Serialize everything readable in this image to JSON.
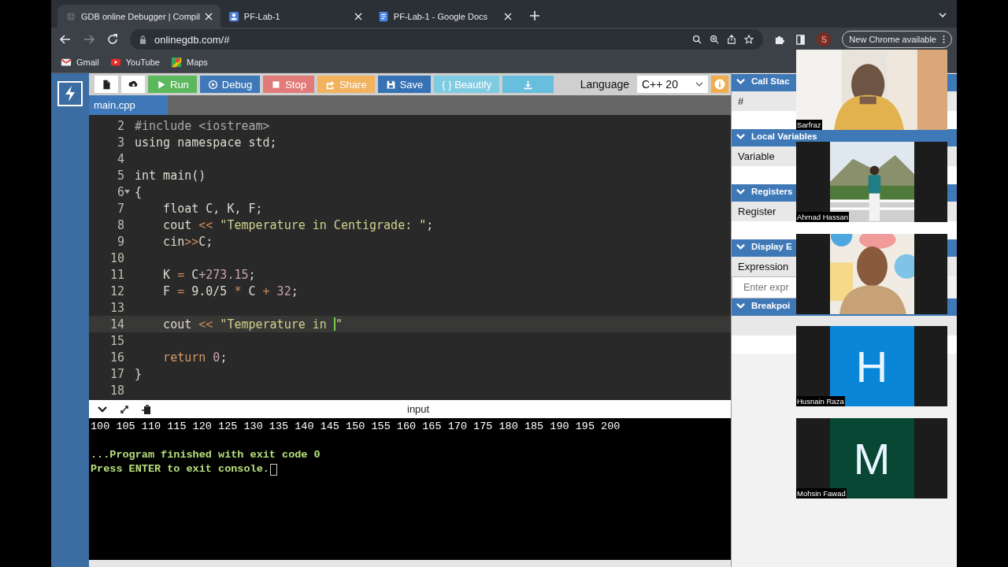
{
  "browser": {
    "tabs": [
      {
        "title": "GDB online Debugger | Compil",
        "selected": true
      },
      {
        "title": "PF-Lab-1",
        "selected": false
      },
      {
        "title": "PF-Lab-1 - Google Docs",
        "selected": false
      }
    ],
    "address": "onlinegdb.com/#",
    "bookmarks": [
      {
        "label": "Gmail"
      },
      {
        "label": "YouTube"
      },
      {
        "label": "Maps"
      }
    ],
    "profile": "S",
    "update_button": "New Chrome available"
  },
  "toolbar": {
    "buttons": [
      {
        "kind": "new-file"
      },
      {
        "kind": "upload"
      },
      {
        "kind": "run",
        "label": "Run"
      },
      {
        "kind": "debug",
        "label": "Debug"
      },
      {
        "kind": "stop",
        "label": "Stop"
      },
      {
        "kind": "share",
        "label": "Share"
      },
      {
        "kind": "save",
        "label": "Save"
      },
      {
        "kind": "beautify",
        "label": "{ } Beautify"
      },
      {
        "kind": "download"
      }
    ],
    "language_label": "Language",
    "language": "C++ 20"
  },
  "file_tab": "main.cpp",
  "editor": {
    "lines": [
      {
        "number": "2",
        "tokens": [
          {
            "kind": "pre",
            "text": "#include <iostream>"
          }
        ]
      },
      {
        "number": "3",
        "tokens": [
          {
            "kind": "plain",
            "text": "using namespace std;"
          }
        ]
      },
      {
        "number": "4"
      },
      {
        "number": "5",
        "tokens": [
          {
            "kind": "plain",
            "text": "int main()"
          }
        ]
      },
      {
        "number": "6",
        "fold": true,
        "tokens": [
          {
            "kind": "plain",
            "text": "{"
          }
        ]
      },
      {
        "number": "7",
        "tokens": [
          {
            "kind": "plain",
            "text": "    float C, K, F;"
          }
        ]
      },
      {
        "number": "8",
        "tokens": [
          {
            "kind": "plain",
            "text": "    cout "
          },
          {
            "kind": "op",
            "text": "<<"
          },
          {
            "kind": "str",
            "text": " \"Temperature in Centigrade: \""
          },
          {
            "kind": "plain",
            "text": ";"
          }
        ]
      },
      {
        "number": "9",
        "tokens": [
          {
            "kind": "plain",
            "text": "    cin"
          },
          {
            "kind": "op",
            "text": ">>"
          },
          {
            "kind": "plain",
            "text": "C;"
          }
        ]
      },
      {
        "number": "10"
      },
      {
        "number": "11",
        "tokens": [
          {
            "kind": "plain",
            "text": "    K "
          },
          {
            "kind": "op",
            "text": "="
          },
          {
            "kind": "plain",
            "text": " C"
          },
          {
            "kind": "num",
            "text": "+273.15"
          },
          {
            "kind": "plain",
            "text": ";"
          }
        ]
      },
      {
        "number": "12",
        "tokens": [
          {
            "kind": "plain",
            "text": "    F "
          },
          {
            "kind": "op",
            "text": "="
          },
          {
            "kind": "plain",
            "text": " 9.0/5 "
          },
          {
            "kind": "op",
            "text": "*"
          },
          {
            "kind": "plain",
            "text": " C "
          },
          {
            "kind": "op",
            "text": "+"
          },
          {
            "kind": "num",
            "text": " 32"
          },
          {
            "kind": "plain",
            "text": ";"
          }
        ]
      },
      {
        "number": "13"
      },
      {
        "number": "14",
        "active": true,
        "tokens": [
          {
            "kind": "plain",
            "text": "    cout "
          },
          {
            "kind": "op",
            "text": "<<"
          },
          {
            "kind": "str",
            "text": " \"Temperature in "
          },
          {
            "kind": "cursor"
          },
          {
            "kind": "str",
            "text": "\""
          }
        ]
      },
      {
        "number": "15"
      },
      {
        "number": "16",
        "tokens": [
          {
            "kind": "kw",
            "text": "    return"
          },
          {
            "kind": "num",
            "text": " 0"
          },
          {
            "kind": "plain",
            "text": ";"
          }
        ]
      },
      {
        "number": "17",
        "tokens": [
          {
            "kind": "plain",
            "text": "}"
          }
        ]
      },
      {
        "number": "18"
      }
    ]
  },
  "console": {
    "title": "input",
    "lines": [
      {
        "kind": "output",
        "text": "100 105 110 115 120 125 130 135 140 145 150 155 160 165 170 175 180 185 190 195 200"
      },
      {
        "kind": "status",
        "text": "...Program finished with exit code 0"
      },
      {
        "kind": "prompt",
        "text": "Press ENTER to exit console."
      }
    ]
  },
  "debugger": {
    "panels": [
      {
        "title": "Call Stac",
        "column": "#"
      },
      {
        "title": "Local Variables",
        "column": "Variable"
      },
      {
        "title": "Registers",
        "column": "Register"
      },
      {
        "title": "Display E",
        "column": "Expression",
        "placeholder": "Enter expr"
      },
      {
        "title": "Breakpoi"
      }
    ]
  },
  "call": {
    "participants": [
      {
        "name": "Sarfraz",
        "kind": "picture",
        "letterbox": false
      },
      {
        "name": "Ahmad Hassan",
        "kind": "picture",
        "letterbox": true
      },
      {
        "kind": "picture",
        "letterbox": true
      },
      {
        "name": "Husnain Raza",
        "kind": "avatar",
        "letter": "H",
        "color": "#0a86d9",
        "letterbox": true
      },
      {
        "name": "Mohsin Fawad",
        "kind": "avatar",
        "letter": "M",
        "color": "#074734",
        "letterbox": true
      }
    ]
  }
}
